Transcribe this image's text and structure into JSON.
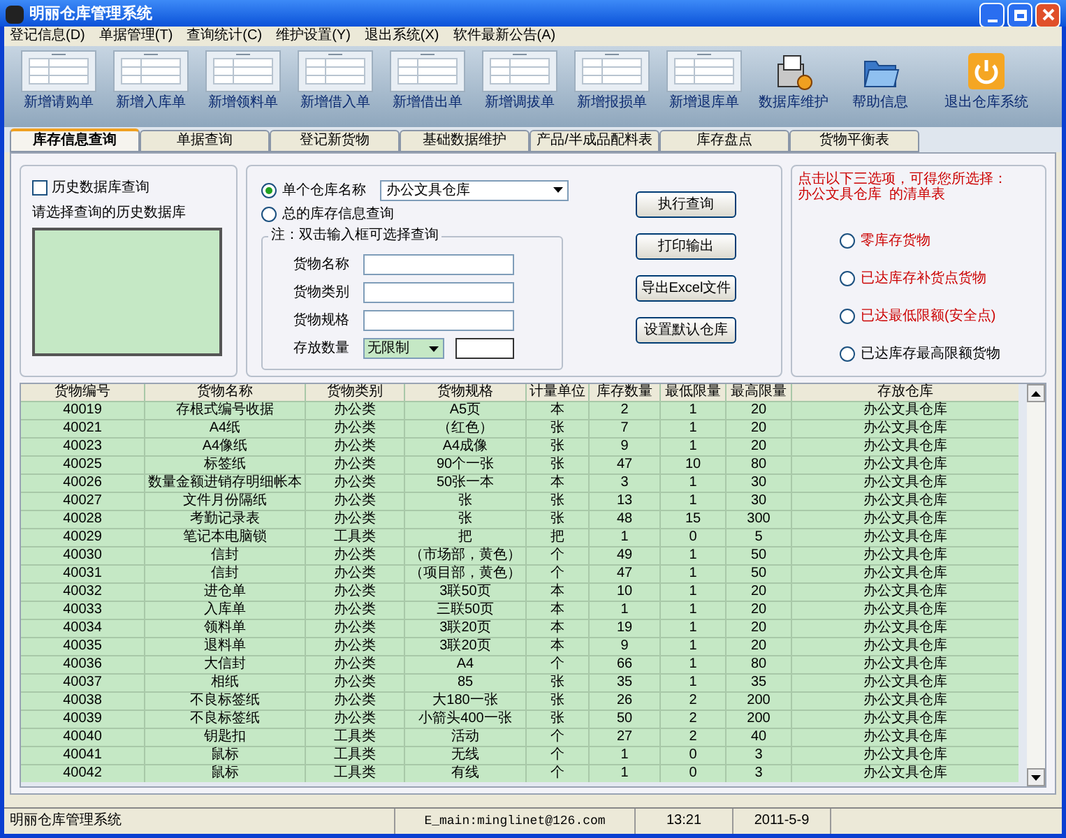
{
  "window": {
    "title": "明丽仓库管理系统"
  },
  "menu": [
    "登记信息(D)",
    "单据管理(T)",
    "查询统计(C)",
    "维护设置(Y)",
    "退出系统(X)",
    "软件最新公告(A)"
  ],
  "toolbar": [
    {
      "kind": "form",
      "label": "新增请购单"
    },
    {
      "kind": "form",
      "label": "新增入库单"
    },
    {
      "kind": "form",
      "label": "新增领料单"
    },
    {
      "kind": "form",
      "label": "新增借入单"
    },
    {
      "kind": "form",
      "label": "新增借出单"
    },
    {
      "kind": "form",
      "label": "新增调拔单"
    },
    {
      "kind": "form",
      "label": "新增报损单"
    },
    {
      "kind": "form",
      "label": "新增退库单"
    },
    {
      "kind": "database",
      "label": "数据库维护"
    },
    {
      "kind": "help",
      "label": "帮助信息"
    },
    {
      "kind": "exit",
      "label": "退出仓库系统"
    }
  ],
  "tabs": [
    {
      "label": "库存信息查询",
      "selected": true
    },
    {
      "label": "单据查询",
      "selected": false
    },
    {
      "label": "登记新货物",
      "selected": false
    },
    {
      "label": "基础数据维护",
      "selected": false
    },
    {
      "label": "产品/半成品配料表",
      "selected": false
    },
    {
      "label": "库存盘点",
      "selected": false
    },
    {
      "label": "货物平衡表",
      "selected": false
    }
  ],
  "history": {
    "label": "历史数据库查询",
    "checked": false,
    "prompt": "请选择查询的历史数据库"
  },
  "query": {
    "modes": [
      {
        "label": "单个仓库名称",
        "selected": true
      },
      {
        "label": "总的库存信息查询",
        "selected": false
      }
    ],
    "warehouse": "办公文具仓库",
    "note": "注：双击输入框可选择查询",
    "fields": [
      {
        "label": "货物名称"
      },
      {
        "label": "货物类别"
      },
      {
        "label": "货物规格"
      }
    ],
    "quantity": {
      "label": "存放数量",
      "value": "无限制"
    },
    "buttons": [
      "执行查询",
      "打印输出",
      "导出Excel文件",
      "设置默认仓库"
    ]
  },
  "filters": {
    "hint": "点击以下三选项，可得您所选择：",
    "hint_2": "办公文具仓库  的清单表",
    "options": [
      {
        "label": "零库存货物",
        "selected": false,
        "color": "#cc0000"
      },
      {
        "label": "已达库存补货点货物",
        "selected": false,
        "color": "#cc0000"
      },
      {
        "label": "已达最低限额(安全点)",
        "selected": false,
        "color": "#cc0000"
      },
      {
        "label": "已达库存最高限额货物",
        "selected": false,
        "color": "#000000"
      }
    ]
  },
  "table": {
    "columns": [
      "货物编号",
      "货物名称",
      "货物类别",
      "货物规格",
      "计量单位",
      "库存数量",
      "最低限量",
      "最高限量",
      "存放仓库"
    ],
    "rows": [
      [
        "40019",
        "存根式编号收据",
        "办公类",
        "A5页",
        "本",
        "2",
        "1",
        "20",
        "办公文具仓库"
      ],
      [
        "40021",
        "A4纸",
        "办公类",
        "（红色）",
        "张",
        "7",
        "1",
        "20",
        "办公文具仓库"
      ],
      [
        "40023",
        "A4像纸",
        "办公类",
        "A4成像",
        "张",
        "9",
        "1",
        "20",
        "办公文具仓库"
      ],
      [
        "40025",
        "标签纸",
        "办公类",
        "90个一张",
        "张",
        "47",
        "10",
        "80",
        "办公文具仓库"
      ],
      [
        "40026",
        "数量金额进销存明细帐本",
        "办公类",
        "50张一本",
        "本",
        "3",
        "1",
        "30",
        "办公文具仓库"
      ],
      [
        "40027",
        "文件月份隔纸",
        "办公类",
        "张",
        "张",
        "13",
        "1",
        "30",
        "办公文具仓库"
      ],
      [
        "40028",
        "考勤记录表",
        "办公类",
        "张",
        "张",
        "48",
        "15",
        "300",
        "办公文具仓库"
      ],
      [
        "40029",
        "笔记本电脑锁",
        "工具类",
        "把",
        "把",
        "1",
        "0",
        "5",
        "办公文具仓库"
      ],
      [
        "40030",
        "信封",
        "办公类",
        "（市场部，黄色）",
        "个",
        "49",
        "1",
        "50",
        "办公文具仓库"
      ],
      [
        "40031",
        "信封",
        "办公类",
        "（项目部，黄色）",
        "个",
        "47",
        "1",
        "50",
        "办公文具仓库"
      ],
      [
        "40032",
        "进仓单",
        "办公类",
        "3联50页",
        "本",
        "10",
        "1",
        "20",
        "办公文具仓库"
      ],
      [
        "40033",
        "入库单",
        "办公类",
        "三联50页",
        "本",
        "1",
        "1",
        "20",
        "办公文具仓库"
      ],
      [
        "40034",
        "领料单",
        "办公类",
        "3联20页",
        "本",
        "19",
        "1",
        "20",
        "办公文具仓库"
      ],
      [
        "40035",
        "退料单",
        "办公类",
        "3联20页",
        "本",
        "9",
        "1",
        "20",
        "办公文具仓库"
      ],
      [
        "40036",
        "大信封",
        "办公类",
        "A4",
        "个",
        "66",
        "1",
        "80",
        "办公文具仓库"
      ],
      [
        "40037",
        "相纸",
        "办公类",
        "85",
        "张",
        "35",
        "1",
        "35",
        "办公文具仓库"
      ],
      [
        "40038",
        "不良标签纸",
        "办公类",
        "大180一张",
        "张",
        "26",
        "2",
        "200",
        "办公文具仓库"
      ],
      [
        "40039",
        "不良标签纸",
        "办公类",
        "小箭头400一张",
        "张",
        "50",
        "2",
        "200",
        "办公文具仓库"
      ],
      [
        "40040",
        "钥匙扣",
        "工具类",
        "活动",
        "个",
        "27",
        "2",
        "40",
        "办公文具仓库"
      ],
      [
        "40041",
        "鼠标",
        "工具类",
        "无线",
        "个",
        "1",
        "0",
        "3",
        "办公文具仓库"
      ],
      [
        "40042",
        "鼠标",
        "工具类",
        "有线",
        "个",
        "1",
        "0",
        "3",
        "办公文具仓库"
      ]
    ]
  },
  "status_bar": [
    "明丽仓库管理系统",
    "E_main:minglinet@126.com",
    "13:21",
    "2011-5-9"
  ]
}
